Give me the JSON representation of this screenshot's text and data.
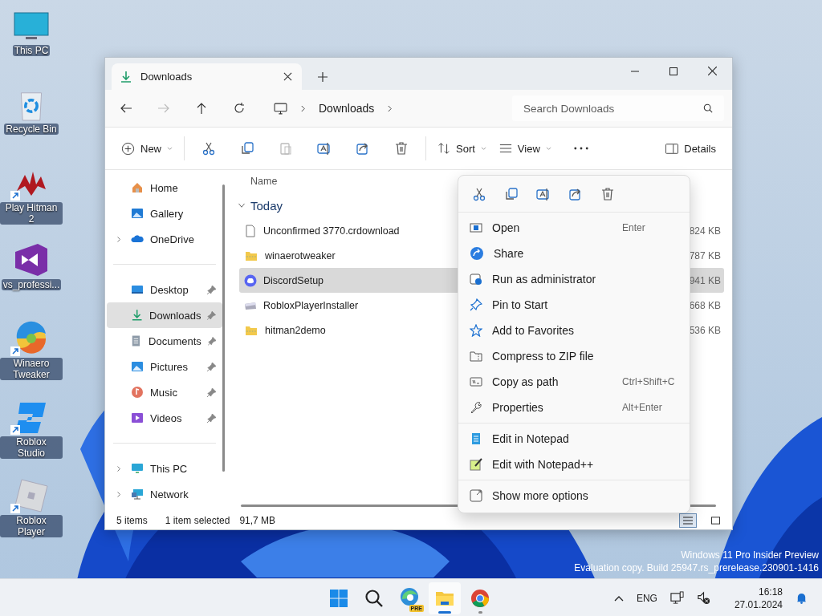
{
  "desktop": {
    "icons": [
      {
        "label": "This PC",
        "shortcut": false
      },
      {
        "label": "Recycle Bin",
        "shortcut": false
      },
      {
        "label": "Play Hitman 2",
        "shortcut": true
      },
      {
        "label": "vs_professi...",
        "shortcut": false
      },
      {
        "label": "Winaero Tweaker",
        "shortcut": true
      },
      {
        "label": "Roblox Studio",
        "shortcut": true
      },
      {
        "label": "Roblox Player",
        "shortcut": true
      }
    ]
  },
  "explorer": {
    "tabs": [
      {
        "title": "Downloads",
        "selected": true
      }
    ],
    "address": {
      "segments": [
        "Downloads"
      ]
    },
    "search": {
      "placeholder": "Search Downloads"
    },
    "toolbar": {
      "new": "New",
      "sort": "Sort",
      "view": "View",
      "details": "Details"
    },
    "sidebar": {
      "groups": [
        {
          "items": [
            {
              "label": "Home",
              "expandable": false,
              "pinned": false,
              "selected": false
            },
            {
              "label": "Gallery",
              "expandable": false,
              "pinned": false,
              "selected": false
            },
            {
              "label": "OneDrive",
              "expandable": true,
              "pinned": false,
              "selected": false
            }
          ]
        },
        {
          "items": [
            {
              "label": "Desktop",
              "expandable": false,
              "pinned": true,
              "selected": false
            },
            {
              "label": "Downloads",
              "expandable": false,
              "pinned": true,
              "selected": true
            },
            {
              "label": "Documents",
              "expandable": false,
              "pinned": true,
              "selected": false
            },
            {
              "label": "Pictures",
              "expandable": false,
              "pinned": true,
              "selected": false
            },
            {
              "label": "Music",
              "expandable": false,
              "pinned": true,
              "selected": false
            },
            {
              "label": "Videos",
              "expandable": false,
              "pinned": true,
              "selected": false
            }
          ]
        },
        {
          "items": [
            {
              "label": "This PC",
              "expandable": true,
              "pinned": false,
              "selected": false
            },
            {
              "label": "Network",
              "expandable": true,
              "pinned": false,
              "selected": false
            }
          ]
        }
      ]
    },
    "file_list": {
      "columns": [
        "Name"
      ],
      "groups": [
        {
          "label": "Today",
          "expanded": true,
          "files": [
            {
              "name": "Unconfirmed 3770.crdownload",
              "size": "824 KB",
              "selected": false
            },
            {
              "name": "winaerotweaker",
              "size": "787 KB",
              "selected": false
            },
            {
              "name": "DiscordSetup",
              "size": "941 KB",
              "selected": true
            },
            {
              "name": "RobloxPlayerInstaller",
              "size": "668 KB",
              "selected": false
            },
            {
              "name": "hitman2demo",
              "size": "536 KB",
              "selected": false
            }
          ]
        }
      ]
    },
    "status_bar": {
      "count": "5 items",
      "selection": "1 item selected",
      "size": "91,7 MB"
    },
    "view_modes": [
      {
        "selected": true
      },
      {
        "selected": false
      }
    ]
  },
  "context_menu": {
    "sections": [
      {
        "items": [
          {
            "label": "Open",
            "shortcut": "Enter"
          },
          {
            "label": "Share"
          },
          {
            "label": "Run as administrator"
          },
          {
            "label": "Pin to Start"
          },
          {
            "label": "Add to Favorites"
          },
          {
            "label": "Compress to ZIP file"
          },
          {
            "label": "Copy as path",
            "shortcut": "Ctrl+Shift+C"
          },
          {
            "label": "Properties",
            "shortcut": "Alt+Enter"
          }
        ]
      },
      {
        "items": [
          {
            "label": "Edit in Notepad"
          },
          {
            "label": "Edit with Notepad++"
          }
        ]
      },
      {
        "items": [
          {
            "label": "Show more options"
          }
        ]
      }
    ]
  },
  "watermark": [
    "Windows 11 Pro Insider Preview",
    "Evaluation copy. Build 25947.rs_prerelease.230901-1416"
  ],
  "taskbar": {
    "apps": [
      {
        "active": false,
        "running": false
      },
      {
        "active": false,
        "running": false
      },
      {
        "active": false,
        "running": false,
        "badge": "PRE"
      },
      {
        "active": true,
        "running": true
      },
      {
        "active": false,
        "running": true
      }
    ],
    "tray": {
      "language": "ENG",
      "time": "16:18",
      "date": "27.01.2024"
    }
  }
}
